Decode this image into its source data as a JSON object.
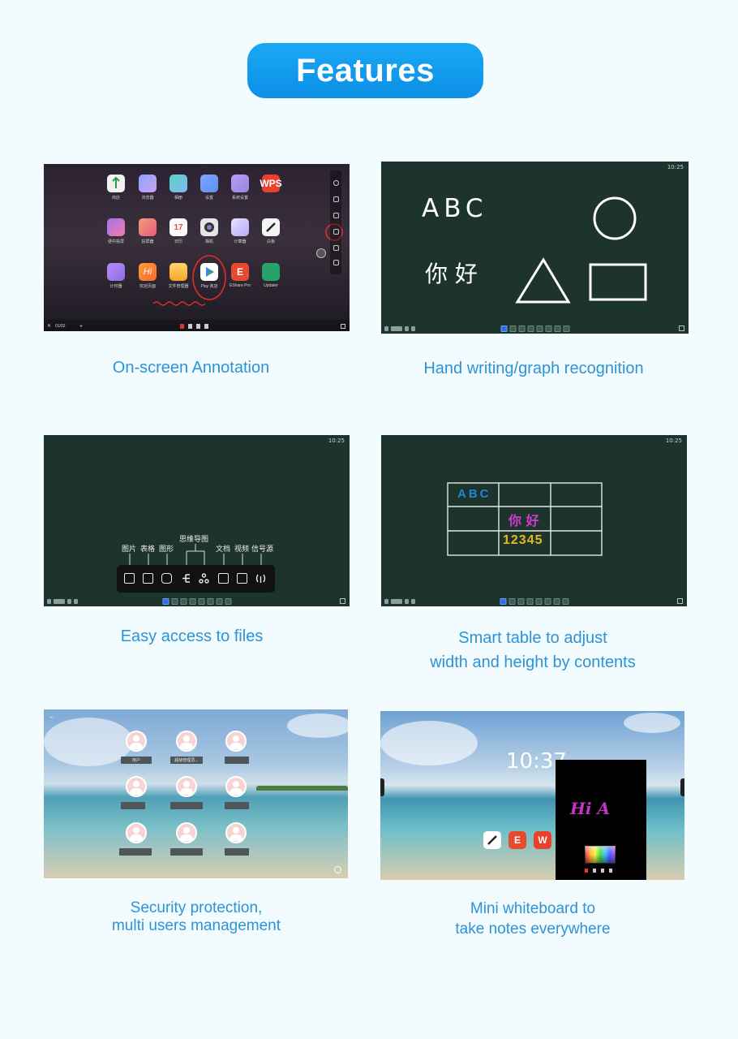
{
  "header": {
    "title": "Features"
  },
  "features": [
    {
      "caption": "On-screen Annotation"
    },
    {
      "caption": "Hand writing/graph recognition"
    },
    {
      "caption": "Easy access to files"
    },
    {
      "caption": "Smart table to adjust\nwidth and height by contents"
    },
    {
      "caption": "Security protection,\nmulti users management"
    },
    {
      "caption": "Mini whiteboard to\ntake notes everywhere"
    }
  ],
  "annotation_screen": {
    "apps_row1": [
      "商店",
      "浏览器",
      "相册",
      "设置",
      "系统设置",
      "WPS"
    ],
    "apps_row2": [
      "便笺",
      "投屏",
      "17",
      "相机",
      "计算器",
      "白板"
    ],
    "apps_row2_labels": [
      "便中投屏",
      "投屏器",
      "日历",
      "相机",
      "计算器",
      "白板"
    ],
    "apps_row3_labels": [
      "计时器",
      "欢迎页面",
      "文件管理器",
      "Play 商店",
      "EShare Pro",
      "Updater"
    ],
    "page_indicator": "01/02"
  },
  "handwriting_screen": {
    "clock": "10:25",
    "text_latin": "ABC",
    "text_cjk": "你 好"
  },
  "files_screen": {
    "clock": "10:25",
    "tools": [
      "图片",
      "表格",
      "图形",
      "思维导图",
      "文档",
      "视频",
      "信号源"
    ]
  },
  "table_screen": {
    "clock": "10:25",
    "cells": [
      "ABC",
      "你 好",
      "12345"
    ]
  },
  "users_screen": {
    "users": [
      "用户",
      "超级管理员...",
      "",
      "",
      "",
      "",
      "",
      "",
      ""
    ]
  },
  "mini_whiteboard_screen": {
    "clock": "10:37",
    "note": "Hi A",
    "app_wps": "W"
  },
  "colors": {
    "accent": "#0b8fe6",
    "caption": "#2e93d6",
    "board": "#1c342c"
  }
}
